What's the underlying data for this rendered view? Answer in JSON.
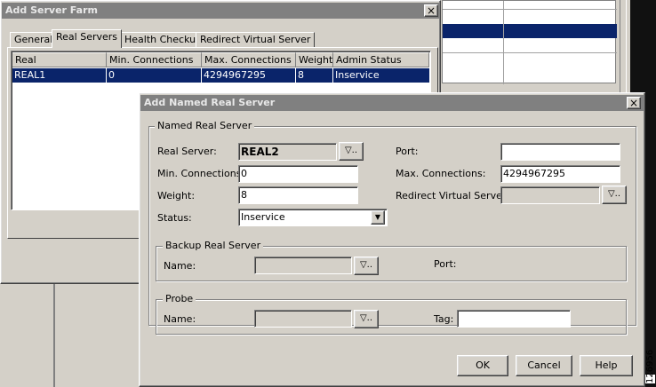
{
  "background_window": {
    "title": "Add Server Farm",
    "close_glyph": "×",
    "tabs": [
      {
        "label": "General"
      },
      {
        "label": "Real Servers"
      },
      {
        "label": "Health Checkup"
      },
      {
        "label": "Redirect Virtual Server"
      }
    ],
    "table": {
      "headers": [
        "Real",
        "Min. Connections",
        "Max. Connections",
        "Weight",
        "Admin Status"
      ],
      "rows": [
        [
          "REAL1",
          "0",
          "4294967295",
          "8",
          "Inservice"
        ]
      ]
    }
  },
  "dialog": {
    "title": "Add Named Real Server",
    "close_glyph": "×",
    "named_group": {
      "legend": "Named Real Server",
      "real_server_label": "Real Server:",
      "real_server_value": "REAL2",
      "min_conn_label": "Min. Connections:",
      "min_conn_value": "0",
      "weight_label": "Weight:",
      "weight_value": "8",
      "status_label": "Status:",
      "status_value": "Inservice",
      "port_label": "Port:",
      "port_value": "",
      "max_conn_label": "Max. Connections:",
      "max_conn_value": "4294967295",
      "redirect_label": "Redirect Virtual Server:",
      "redirect_value": ""
    },
    "backup_group": {
      "legend": "Backup Real Server",
      "name_label": "Name:",
      "port_label": "Port:"
    },
    "probe_group": {
      "legend": "Probe",
      "name_label": "Name:",
      "tag_label": "Tag:"
    },
    "buttons": {
      "ok": "OK",
      "cancel": "Cancel",
      "help": "Help"
    },
    "browse_glyph": "▽..",
    "dropdown_glyph": "▼"
  },
  "figure_id": "126956",
  "colors": {
    "selection": "#0a246a",
    "face": "#d4d0c8",
    "inactive_title": "#808080"
  }
}
